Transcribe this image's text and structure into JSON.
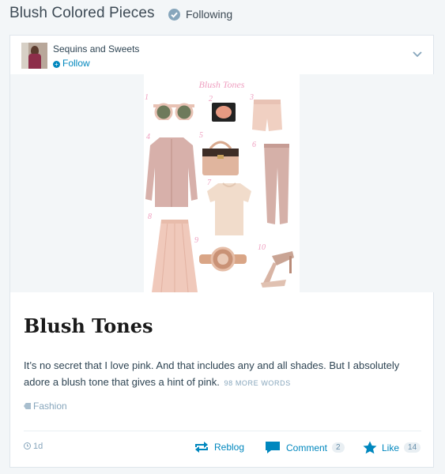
{
  "header": {
    "title": "Blush Colored Pieces",
    "following_label": "Following"
  },
  "post": {
    "site_name": "Sequins and Sweets",
    "follow_label": "Follow",
    "image": {
      "collage_title": "Blush Tones",
      "numbers": [
        "1",
        "2",
        "3",
        "4",
        "5",
        "6",
        "7",
        "8",
        "9",
        "10"
      ]
    },
    "title": "Blush Tones",
    "excerpt": "It’s no secret that I love pink. And that includes any and all shades. But I absolutely adore a blush tone that gives a hint of pink.",
    "more_words": "98 MORE WORDS",
    "tag": "Fashion",
    "time": "1d",
    "actions": {
      "reblog": "Reblog",
      "comment": "Comment",
      "comment_count": "2",
      "like": "Like",
      "like_count": "14"
    }
  },
  "colors": {
    "link": "#0087be",
    "muted": "#87a6bc",
    "accent_pink": "#ef9fc0"
  }
}
